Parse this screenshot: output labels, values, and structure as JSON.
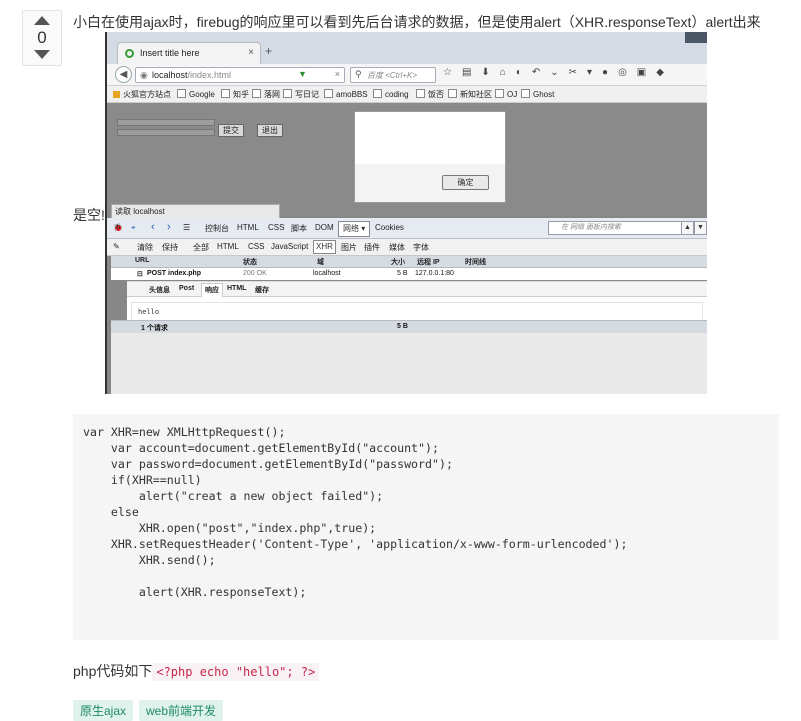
{
  "vote": {
    "count": "0"
  },
  "question": {
    "text_line1": "小白在使用ajax时，firebug的响应里可以看到先后台请求的数据，但是使用alert（XHR.responseText）alert出来",
    "text_line2": "是空!"
  },
  "browser": {
    "tab_title": "Insert title here",
    "url_host": "localhost",
    "url_path": "/index.html",
    "search_placeholder": "百度 <Ctrl+K>",
    "bookmarks": [
      "火狐官方站点",
      "Google",
      "知乎",
      "落网",
      "写日记",
      "amoBBS",
      "coding",
      "饭否",
      "新知社区",
      "OJ",
      "Ghost"
    ],
    "page_buttons": [
      "提交",
      "退出"
    ],
    "dialog_ok": "确定",
    "status_text": "读取 localhost"
  },
  "firebug": {
    "toolbar_items": [
      "控制台",
      "HTML",
      "CSS",
      "脚本",
      "DOM"
    ],
    "network_tab": "网络 ▾",
    "cookies_tab": "Cookies",
    "search_placeholder": "在 网络 面板内搜索",
    "filters": [
      "清除",
      "保持",
      "全部",
      "HTML",
      "CSS",
      "JavaScript",
      "XHR",
      "图片",
      "插件",
      "媒体",
      "字体"
    ],
    "columns": [
      "URL",
      "状态",
      "域",
      "大小",
      "远程 IP",
      "时间线"
    ],
    "request": {
      "url": "POST index.php",
      "status": "200 OK",
      "domain": "localhost",
      "size": "5 B",
      "ip": "127.0.0.1:80"
    },
    "detail_tabs": [
      "头信息",
      "Post",
      "响应",
      "HTML",
      "缓存"
    ],
    "response_value": "hello",
    "summary_count": "1 个请求",
    "summary_size": "5 B"
  },
  "code": {
    "lines": [
      "var XHR=new XMLHttpRequest();",
      "    var account=document.getElementById(\"account\");",
      "    var password=document.getElementById(\"password\");",
      "    if(XHR==null)",
      "        alert(\"creat a new object failed\");",
      "    else",
      "        XHR.open(\"post\",\"index.php\",true);",
      "    XHR.setRequestHeader('Content-Type', 'application/x-www-form-urlencoded');",
      "        XHR.send();",
      "",
      "        alert(XHR.responseText);"
    ]
  },
  "php_line": {
    "label": "php代码如下",
    "code": "<?php echo \"hello\"; ?>"
  },
  "tags": [
    "原生ajax",
    "web前端开发"
  ]
}
